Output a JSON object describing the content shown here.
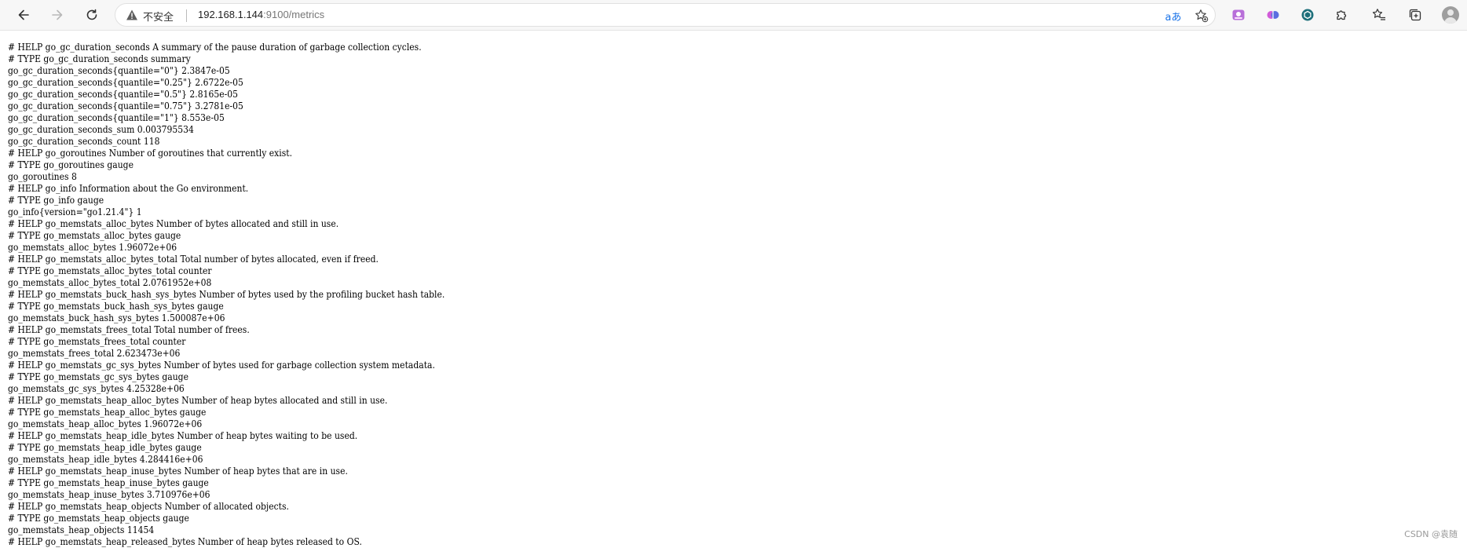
{
  "address_bar": {
    "security_label": "不安全",
    "url_host": "192.168.1.144",
    "url_rest": ":9100/metrics"
  },
  "icons": {
    "back": "arrow-left-icon",
    "forward": "arrow-right-icon",
    "reload": "reload-icon",
    "warning": "warning-triangle-icon",
    "translate": "translate-icon",
    "favorite": "star-add-icon",
    "extensions": "puzzle-icon",
    "favorites_bar": "star-list-icon",
    "collections": "collections-icon",
    "profile": "avatar-icon"
  },
  "translate_glyph": "aあ",
  "lines": [
    "# HELP go_gc_duration_seconds A summary of the pause duration of garbage collection cycles.",
    "# TYPE go_gc_duration_seconds summary",
    "go_gc_duration_seconds{quantile=\"0\"} 2.3847e-05",
    "go_gc_duration_seconds{quantile=\"0.25\"} 2.6722e-05",
    "go_gc_duration_seconds{quantile=\"0.5\"} 2.8165e-05",
    "go_gc_duration_seconds{quantile=\"0.75\"} 3.2781e-05",
    "go_gc_duration_seconds{quantile=\"1\"} 8.553e-05",
    "go_gc_duration_seconds_sum 0.003795534",
    "go_gc_duration_seconds_count 118",
    "# HELP go_goroutines Number of goroutines that currently exist.",
    "# TYPE go_goroutines gauge",
    "go_goroutines 8",
    "# HELP go_info Information about the Go environment.",
    "# TYPE go_info gauge",
    "go_info{version=\"go1.21.4\"} 1",
    "# HELP go_memstats_alloc_bytes Number of bytes allocated and still in use.",
    "# TYPE go_memstats_alloc_bytes gauge",
    "go_memstats_alloc_bytes 1.96072e+06",
    "# HELP go_memstats_alloc_bytes_total Total number of bytes allocated, even if freed.",
    "# TYPE go_memstats_alloc_bytes_total counter",
    "go_memstats_alloc_bytes_total 2.0761952e+08",
    "# HELP go_memstats_buck_hash_sys_bytes Number of bytes used by the profiling bucket hash table.",
    "# TYPE go_memstats_buck_hash_sys_bytes gauge",
    "go_memstats_buck_hash_sys_bytes 1.500087e+06",
    "# HELP go_memstats_frees_total Total number of frees.",
    "# TYPE go_memstats_frees_total counter",
    "go_memstats_frees_total 2.623473e+06",
    "# HELP go_memstats_gc_sys_bytes Number of bytes used for garbage collection system metadata.",
    "# TYPE go_memstats_gc_sys_bytes gauge",
    "go_memstats_gc_sys_bytes 4.25328e+06",
    "# HELP go_memstats_heap_alloc_bytes Number of heap bytes allocated and still in use.",
    "# TYPE go_memstats_heap_alloc_bytes gauge",
    "go_memstats_heap_alloc_bytes 1.96072e+06",
    "# HELP go_memstats_heap_idle_bytes Number of heap bytes waiting to be used.",
    "# TYPE go_memstats_heap_idle_bytes gauge",
    "go_memstats_heap_idle_bytes 4.284416e+06",
    "# HELP go_memstats_heap_inuse_bytes Number of heap bytes that are in use.",
    "# TYPE go_memstats_heap_inuse_bytes gauge",
    "go_memstats_heap_inuse_bytes 3.710976e+06",
    "# HELP go_memstats_heap_objects Number of allocated objects.",
    "# TYPE go_memstats_heap_objects gauge",
    "go_memstats_heap_objects 11454",
    "# HELP go_memstats_heap_released_bytes Number of heap bytes released to OS."
  ],
  "watermark": "CSDN @袁随"
}
